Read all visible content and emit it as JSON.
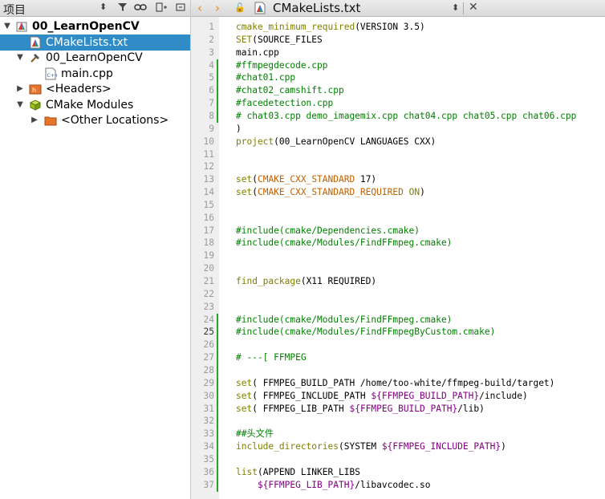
{
  "project_panel": {
    "title": "项目",
    "tree": [
      {
        "label": "00_LearnOpenCV",
        "depth": 0,
        "expanded": true,
        "icon": "project-icon",
        "bold": true
      },
      {
        "label": "CMakeLists.txt",
        "depth": 1,
        "expanded": null,
        "icon": "cmake-file-icon",
        "selected": true
      },
      {
        "label": "00_LearnOpenCV",
        "depth": 1,
        "expanded": true,
        "icon": "hammer-icon"
      },
      {
        "label": "main.cpp",
        "depth": 2,
        "expanded": null,
        "icon": "cpp-file-icon"
      },
      {
        "label": "<Headers>",
        "depth": 1,
        "expanded": false,
        "icon": "headers-icon"
      },
      {
        "label": "CMake Modules",
        "depth": 1,
        "expanded": true,
        "icon": "cmake-modules-icon"
      },
      {
        "label": "<Other Locations>",
        "depth": 2,
        "expanded": false,
        "icon": "folder-icon"
      }
    ]
  },
  "editor": {
    "filename": "CMakeLists.txt",
    "lines": [
      {
        "n": "1",
        "segs": [
          [
            "f",
            "cmake_minimum_required"
          ],
          [
            "p",
            "(VERSION 3.5)"
          ]
        ]
      },
      {
        "n": "2",
        "segs": [
          [
            "f",
            "SET"
          ],
          [
            "p",
            "(SOURCE_FILES"
          ]
        ]
      },
      {
        "n": "3",
        "segs": [
          [
            "p",
            "main.cpp"
          ]
        ]
      },
      {
        "n": "4",
        "mark": true,
        "segs": [
          [
            "c",
            "#ffmpegdecode.cpp"
          ]
        ]
      },
      {
        "n": "5",
        "mark": true,
        "segs": [
          [
            "c",
            "#chat01.cpp"
          ]
        ]
      },
      {
        "n": "6",
        "mark": true,
        "segs": [
          [
            "c",
            "#chat02_camshift.cpp"
          ]
        ]
      },
      {
        "n": "7",
        "mark": true,
        "segs": [
          [
            "c",
            "#facedetection.cpp"
          ]
        ]
      },
      {
        "n": "8",
        "mark": true,
        "segs": [
          [
            "c",
            "# chat03.cpp demo_imagemix.cpp chat04.cpp chat05.cpp chat06.cpp"
          ]
        ]
      },
      {
        "n": "9",
        "segs": [
          [
            "p",
            ")"
          ]
        ]
      },
      {
        "n": "10",
        "segs": [
          [
            "f",
            "project"
          ],
          [
            "p",
            "(00_LearnOpenCV LANGUAGES CXX)"
          ]
        ]
      },
      {
        "n": "11",
        "segs": []
      },
      {
        "n": "12",
        "segs": []
      },
      {
        "n": "13",
        "segs": [
          [
            "f",
            "set"
          ],
          [
            "p",
            "("
          ],
          [
            "k",
            "CMAKE_CXX_STANDARD"
          ],
          [
            "p",
            " 17)"
          ]
        ]
      },
      {
        "n": "14",
        "segs": [
          [
            "f",
            "set"
          ],
          [
            "p",
            "("
          ],
          [
            "k",
            "CMAKE_CXX_STANDARD_REQUIRED"
          ],
          [
            "p",
            " "
          ],
          [
            "f",
            "ON"
          ],
          [
            "p",
            ")"
          ]
        ]
      },
      {
        "n": "15",
        "segs": []
      },
      {
        "n": "16",
        "segs": []
      },
      {
        "n": "17",
        "segs": [
          [
            "c",
            "#include(cmake/Dependencies.cmake)"
          ]
        ]
      },
      {
        "n": "18",
        "segs": [
          [
            "c",
            "#include(cmake/Modules/FindFFmpeg.cmake)"
          ]
        ]
      },
      {
        "n": "19",
        "segs": []
      },
      {
        "n": "20",
        "segs": []
      },
      {
        "n": "21",
        "segs": [
          [
            "f",
            "find_package"
          ],
          [
            "p",
            "(X11 REQUIRED)"
          ]
        ]
      },
      {
        "n": "22",
        "segs": []
      },
      {
        "n": "23",
        "segs": []
      },
      {
        "n": "24",
        "mark": true,
        "segs": [
          [
            "c",
            "#include(cmake/Modules/FindFFmpeg.cmake)"
          ]
        ]
      },
      {
        "n": "25",
        "mark": true,
        "cur": true,
        "segs": [
          [
            "c",
            "#include(cmake/Modules/FindFFmpegByCustom.cmake)"
          ]
        ]
      },
      {
        "n": "26",
        "mark": true,
        "segs": []
      },
      {
        "n": "27",
        "mark": true,
        "segs": [
          [
            "c",
            "# ---[ FFMPEG"
          ]
        ]
      },
      {
        "n": "28",
        "mark": true,
        "segs": []
      },
      {
        "n": "29",
        "mark": true,
        "segs": [
          [
            "f",
            "set"
          ],
          [
            "p",
            "( FFMPEG_BUILD_PATH /home/too-white/ffmpeg-build/target)"
          ]
        ]
      },
      {
        "n": "30",
        "mark": true,
        "segs": [
          [
            "f",
            "set"
          ],
          [
            "p",
            "( FFMPEG_INCLUDE_PATH "
          ],
          [
            "v",
            "${FFMPEG_BUILD_PATH}"
          ],
          [
            "p",
            "/include)"
          ]
        ]
      },
      {
        "n": "31",
        "mark": true,
        "segs": [
          [
            "f",
            "set"
          ],
          [
            "p",
            "( FFMPEG_LIB_PATH "
          ],
          [
            "v",
            "${FFMPEG_BUILD_PATH}"
          ],
          [
            "p",
            "/lib)"
          ]
        ]
      },
      {
        "n": "32",
        "mark": true,
        "segs": []
      },
      {
        "n": "33",
        "mark": true,
        "segs": [
          [
            "c",
            "##头文件"
          ]
        ]
      },
      {
        "n": "34",
        "mark": true,
        "segs": [
          [
            "f",
            "include_directories"
          ],
          [
            "p",
            "(SYSTEM "
          ],
          [
            "v",
            "${FFMPEG_INCLUDE_PATH}"
          ],
          [
            "p",
            ")"
          ]
        ]
      },
      {
        "n": "35",
        "mark": true,
        "segs": []
      },
      {
        "n": "36",
        "mark": true,
        "segs": [
          [
            "f",
            "list"
          ],
          [
            "p",
            "(APPEND LINKER_LIBS"
          ]
        ]
      },
      {
        "n": "37",
        "mark": true,
        "segs": [
          [
            "p",
            "    "
          ],
          [
            "v",
            "${FFMPEG_LIB_PATH}"
          ],
          [
            "p",
            "/libavcodec.so"
          ]
        ]
      }
    ]
  }
}
